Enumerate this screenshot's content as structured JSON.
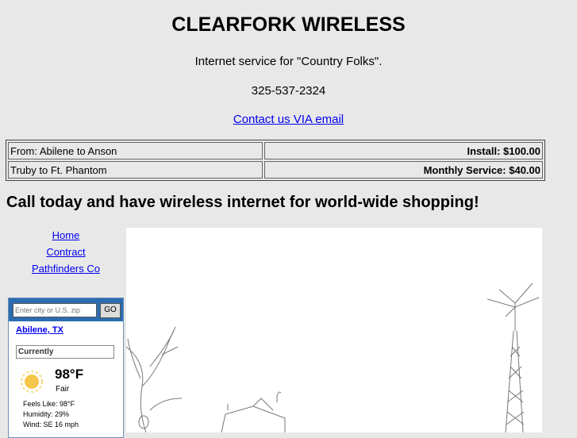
{
  "header": {
    "title": "CLEARFORK WIRELESS",
    "tagline": "Internet service for \"Country Folks\".",
    "phone": "325-537-2324",
    "contact_link": "Contact us VIA email"
  },
  "info_table": {
    "rows": [
      {
        "left": "From: Abilene to Anson",
        "right": "Install: $100.00"
      },
      {
        "left": "Truby to Ft. Phantom",
        "right": "Monthly Service: $40.00"
      }
    ]
  },
  "cta": "Call today and have wireless internet for world-wide shopping!",
  "nav": {
    "items": [
      "Home",
      "Contract",
      "Pathfinders Co"
    ]
  },
  "weather": {
    "search_placeholder": "Enter city or U.S. zip",
    "go_label": "GO",
    "city": "Abilene, TX",
    "currently_label": "Currently",
    "temperature": "98°F",
    "condition": "Fair",
    "feels_like": "Feels Like: 98°F",
    "humidity": "Humidity: 29%",
    "wind": "Wind: SE 16 mph",
    "icon": "sun-icon"
  },
  "colors": {
    "background": "#e8e8e8",
    "link": "#0000ee",
    "weather_bar": "#2b6db0"
  }
}
